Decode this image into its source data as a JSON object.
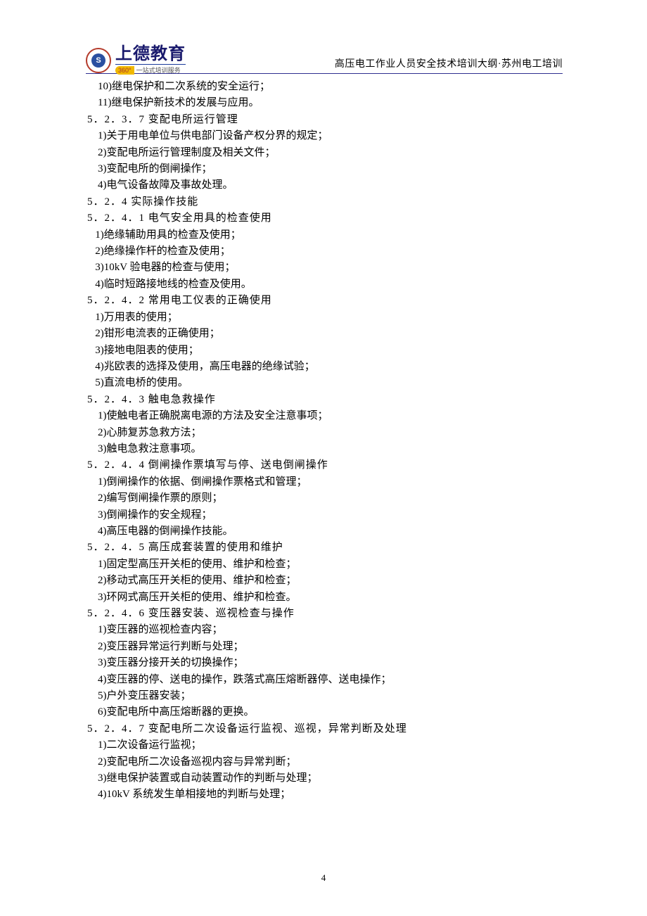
{
  "header": {
    "logo_main": "上德教育",
    "logo_pill": "360°",
    "logo_sub": "一站式培训服务",
    "logo_letter": "S",
    "right": "高压电工作业人员安全技术培训大纲·苏州电工培训"
  },
  "page_number": "4",
  "lines": [
    {
      "cls": "item",
      "text": "    10)继电保护和二次系统的安全运行；"
    },
    {
      "cls": "item",
      "text": "    11)继电保护新技术的发展与应用。"
    },
    {
      "cls": "h4",
      "text": "5．2．3．7 变配电所运行管理"
    },
    {
      "cls": "item",
      "text": "    1)关于用电单位与供电部门设备产权分界的规定；"
    },
    {
      "cls": "item",
      "text": "    2)变配电所运行管理制度及相关文件；"
    },
    {
      "cls": "item",
      "text": "    3)变配电所的倒闸操作；"
    },
    {
      "cls": "item",
      "text": "    4)电气设备故障及事故处理。"
    },
    {
      "cls": "h3",
      "text": "5．2．4 实际操作技能"
    },
    {
      "cls": "h4",
      "text": "5．2．4．1 电气安全用具的检查使用"
    },
    {
      "cls": "item",
      "text": "   1)绝缘辅助用具的检查及使用；"
    },
    {
      "cls": "item",
      "text": "   2)绝缘操作杆的检查及使用；"
    },
    {
      "cls": "item",
      "text": "   3)10kV 验电器的检查与使用；"
    },
    {
      "cls": "item",
      "text": "   4)临时短路接地线的检查及使用。"
    },
    {
      "cls": "h4",
      "text": "5．2．4．2 常用电工仪表的正确使用"
    },
    {
      "cls": "item",
      "text": "   1)万用表的使用；"
    },
    {
      "cls": "item",
      "text": "   2)钳形电流表的正确使用；"
    },
    {
      "cls": "item",
      "text": "   3)接地电阻表的使用；"
    },
    {
      "cls": "item",
      "text": "   4)兆欧表的选择及使用，高压电器的绝缘试验；"
    },
    {
      "cls": "item",
      "text": "   5)直流电桥的使用。"
    },
    {
      "cls": "h4",
      "text": "5．2．4．3 触电急救操作"
    },
    {
      "cls": "item",
      "text": "    1)使触电者正确脱离电源的方法及安全注意事项；"
    },
    {
      "cls": "item",
      "text": "    2)心肺复苏急救方法；"
    },
    {
      "cls": "item",
      "text": "    3)触电急救注意事项。"
    },
    {
      "cls": "h4",
      "text": "5．2．4．4 倒闸操作票填写与停、送电倒闸操作"
    },
    {
      "cls": "item",
      "text": "    1)倒闸操作的依据、倒闸操作票格式和管理；"
    },
    {
      "cls": "item",
      "text": "    2)编写倒闸操作票的原则；"
    },
    {
      "cls": "item",
      "text": "    3)倒闸操作的安全规程；"
    },
    {
      "cls": "item",
      "text": "    4)高压电器的倒闸操作技能。"
    },
    {
      "cls": "h4",
      "text": "5．2．4．5 高压成套装置的使用和维护"
    },
    {
      "cls": "item",
      "text": "    1)固定型高压开关柜的使用、维护和检查；"
    },
    {
      "cls": "item",
      "text": "    2)移动式高压开关柜的使用、维护和检查；"
    },
    {
      "cls": "item",
      "text": "    3)环网式高压开关柜的使用、维护和检查。"
    },
    {
      "cls": "h4",
      "text": "5．2．4．6 变压器安装、巡视检查与操作"
    },
    {
      "cls": "item",
      "text": "    1)变压器的巡视检查内容；"
    },
    {
      "cls": "item",
      "text": "    2)变压器异常运行判断与处理；"
    },
    {
      "cls": "item",
      "text": "    3)变压器分接开关的切换操作；"
    },
    {
      "cls": "item",
      "text": "    4)变压器的停、送电的操作，跌落式高压熔断器停、送电操作；"
    },
    {
      "cls": "item",
      "text": "    5)户外变压器安装；"
    },
    {
      "cls": "item",
      "text": "    6)变配电所中高压熔断器的更换。"
    },
    {
      "cls": "h4",
      "text": "5．2．4．7 变配电所二次设备运行监视、巡视，异常判断及处理"
    },
    {
      "cls": "item",
      "text": "    1)二次设备运行监视；"
    },
    {
      "cls": "item",
      "text": "    2)变配电所二次设备巡视内容与异常判断；"
    },
    {
      "cls": "item",
      "text": "    3)继电保护装置或自动装置动作的判断与处理；"
    },
    {
      "cls": "item",
      "text": "    4)10kV 系统发生单相接地的判断与处理；"
    }
  ]
}
